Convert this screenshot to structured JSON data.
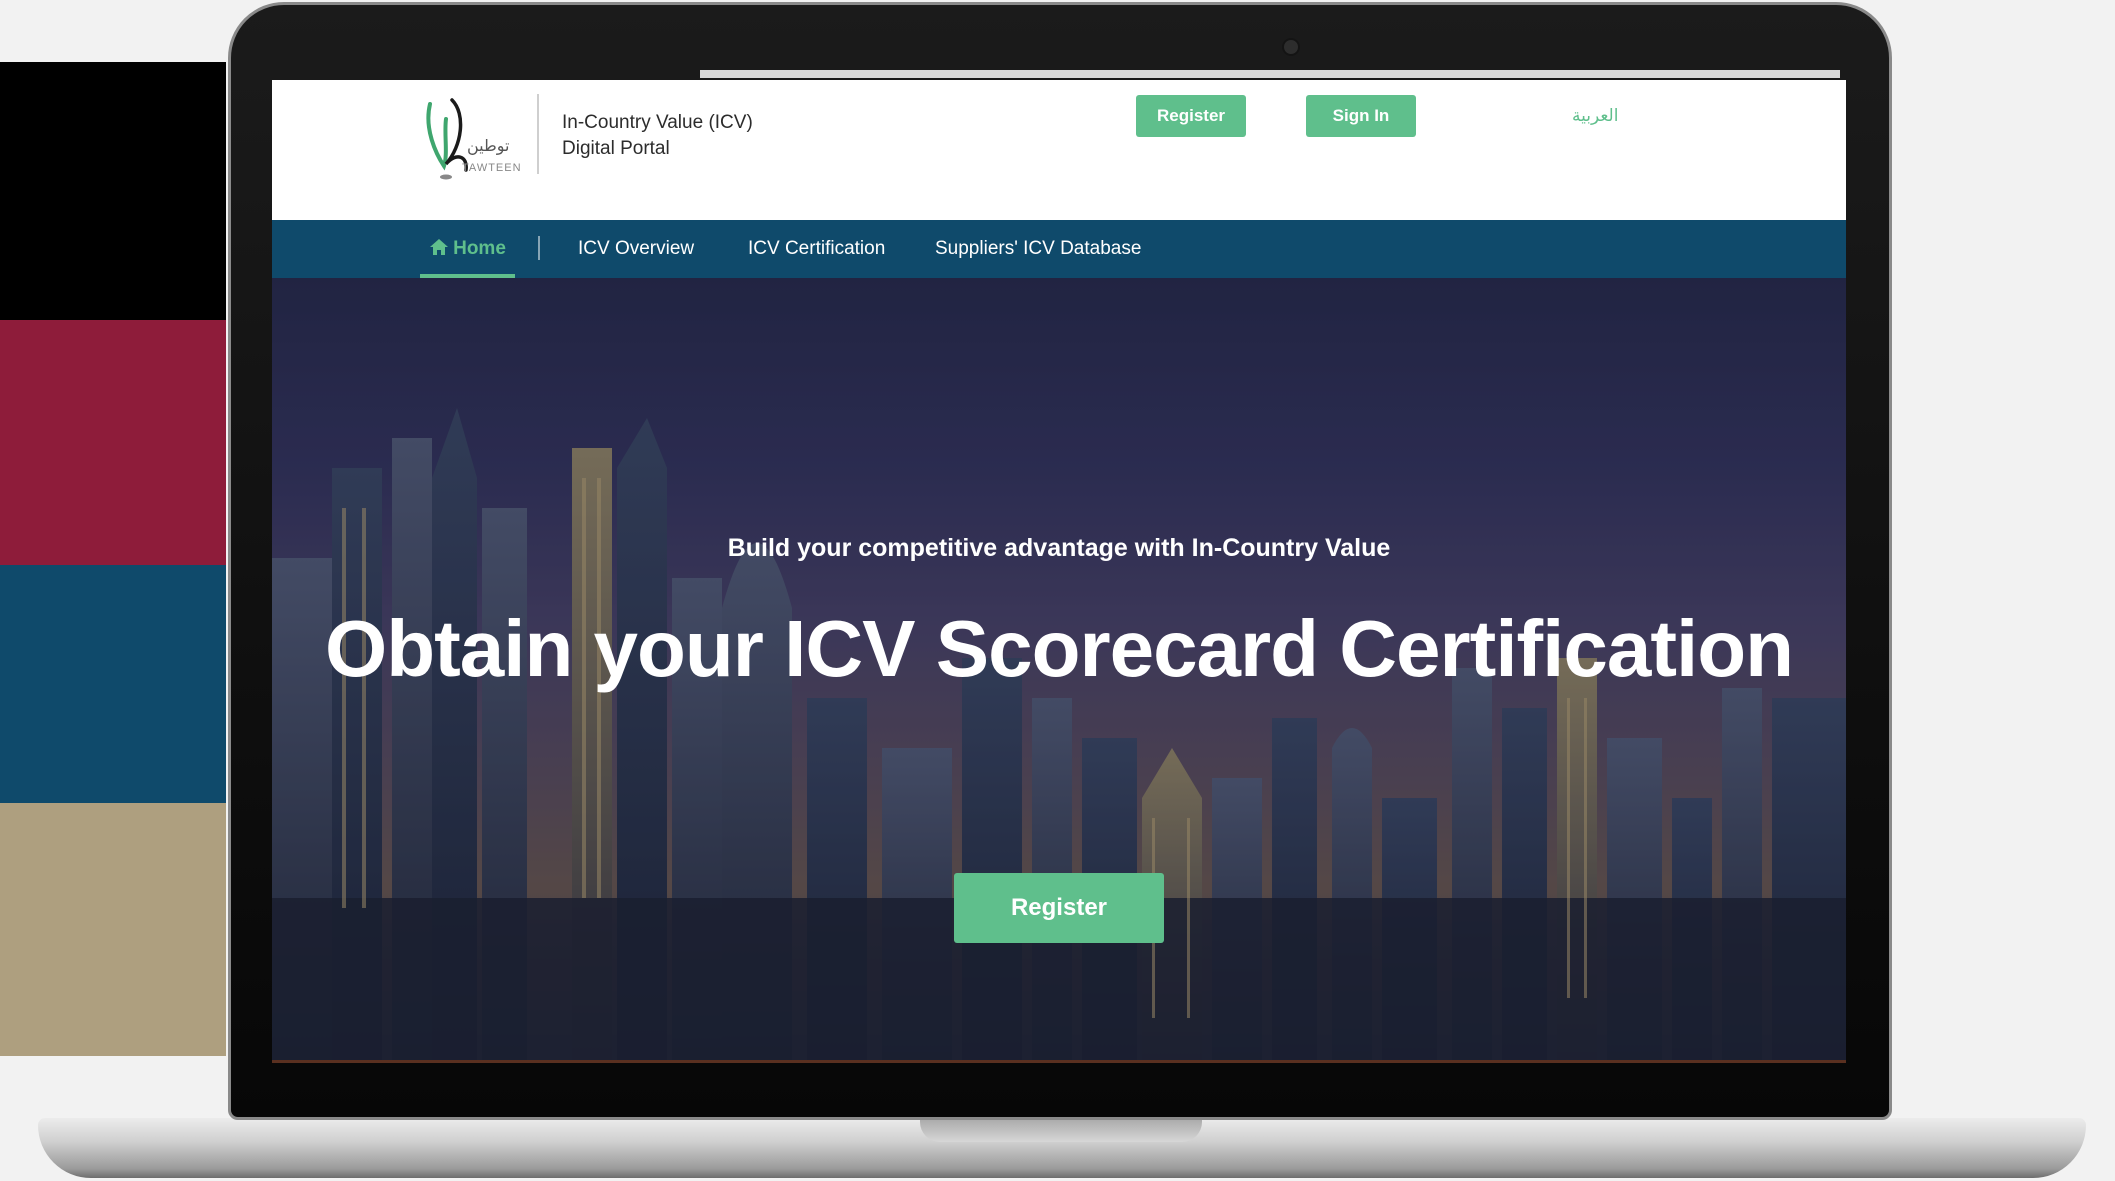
{
  "colors": {
    "swatch_black": "#000000",
    "swatch_crimson": "#8e1c3a",
    "swatch_navy": "#0f4a6b",
    "swatch_tan": "#ae9f7f",
    "accent_green": "#5fbf8c",
    "nav_blue": "#0f4a6b"
  },
  "header": {
    "logo": {
      "arabic_text": "توطين",
      "latin_text": "TAWTEEN"
    },
    "portal_title_line1": "In-Country Value (ICV)",
    "portal_title_line2": "Digital Portal",
    "register_label": "Register",
    "signin_label": "Sign In",
    "language_label": "العربية"
  },
  "nav": {
    "items": [
      {
        "label": "Home",
        "icon": "home-icon",
        "active": true
      },
      {
        "label": "ICV Overview"
      },
      {
        "label": "ICV Certification"
      },
      {
        "label": "Suppliers' ICV Database"
      }
    ]
  },
  "hero": {
    "subtitle": "Build your competitive advantage with In-Country Value",
    "title": "Obtain your ICV Scorecard Certification",
    "register_label": "Register"
  }
}
